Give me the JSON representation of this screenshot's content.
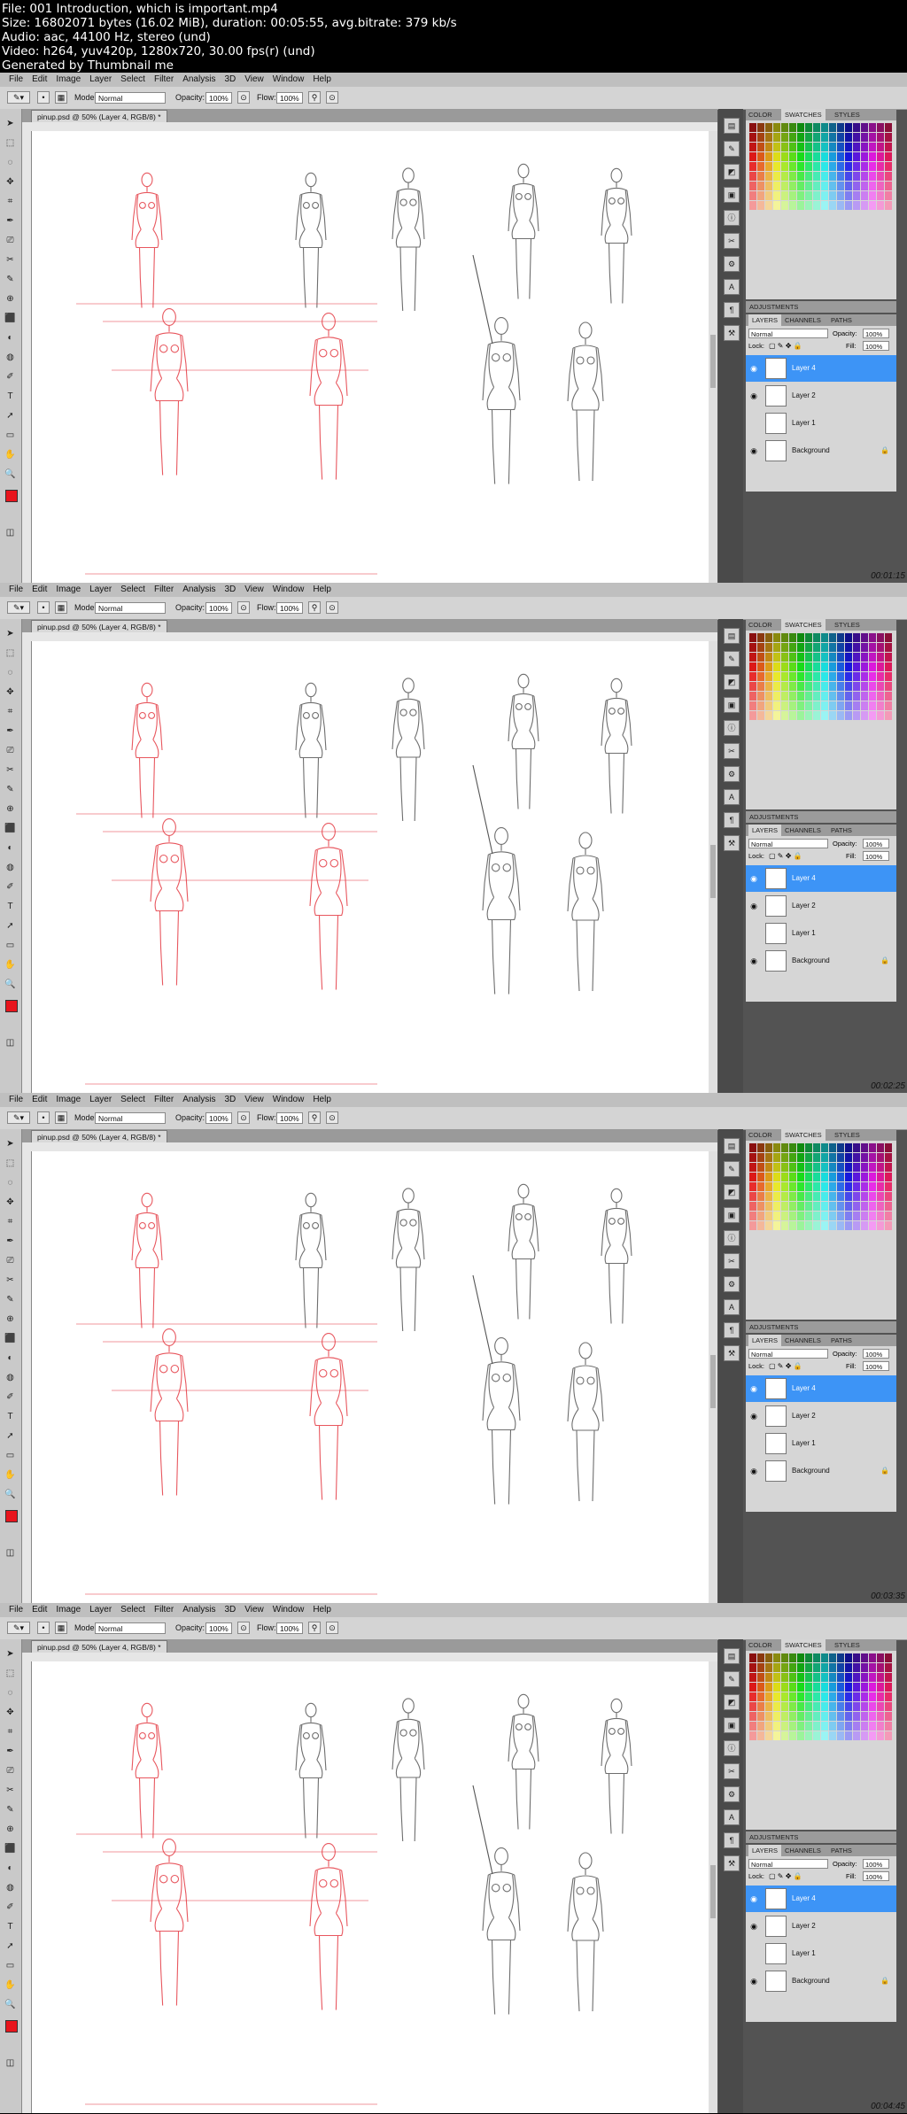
{
  "header": {
    "lines": [
      "File: 001 Introduction, which is important.mp4",
      "Size: 16802071 bytes (16.02 MiB), duration: 00:05:55, avg.bitrate: 379 kb/s",
      "Audio: aac, 44100 Hz, stereo (und)",
      "Video: h264, yuv420p, 1280x720, 30.00 fps(r) (und)",
      "Generated by Thumbnail me"
    ]
  },
  "app": {
    "menu": [
      "File",
      "Edit",
      "Image",
      "Layer",
      "Select",
      "Filter",
      "Analysis",
      "3D",
      "View",
      "Window",
      "Help"
    ],
    "options": {
      "mode_label": "Mode:",
      "mode_value": "Normal",
      "opacity_label": "Opacity:",
      "opacity_value": "100%",
      "flow_label": "Flow:",
      "flow_value": "100%"
    },
    "doc_tab": "pinup.psd @ 50% (Layer 4, RGB/8) *",
    "panel_tabs_top": [
      "COLOR",
      "SWATCHES",
      "STYLES"
    ],
    "adjustments_label": "ADJUSTMENTS",
    "panel_tabs_layers": [
      "LAYERS",
      "CHANNELS",
      "PATHS"
    ],
    "layers_blend": "Normal",
    "layers_opacity_label": "Opacity:",
    "layers_opacity": "100%",
    "lock_label": "Lock:",
    "fill_label": "Fill:",
    "fill_value": "100%",
    "layers": [
      "Layer 4",
      "Layer 2",
      "Layer 1",
      "Background"
    ]
  },
  "frames": [
    {
      "timestamp": "00:01:15"
    },
    {
      "timestamp": "00:02:25"
    },
    {
      "timestamp": "00:03:35"
    },
    {
      "timestamp": "00:04:45"
    }
  ],
  "colors": {
    "menubar": "#bfbfbf",
    "selected_layer": "#3d94f6",
    "foreground": "#e8141c",
    "sketch_red": "#e43a43",
    "sketch_gray": "#555555"
  }
}
